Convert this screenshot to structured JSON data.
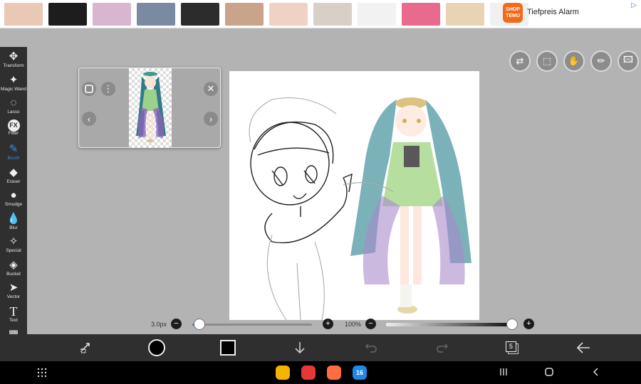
{
  "ad": {
    "brand_lines": [
      "SHOP",
      "TEMU"
    ],
    "title": "Tiefpreis Alarm",
    "choice_icon": "ad-choices-icon",
    "thumbs": [
      "#e9c9b5",
      "#1d1d1d",
      "#d9b6cf",
      "#7a8aa0",
      "#2c2c2c",
      "#c9a38a",
      "#f0d2c4",
      "#d8cfc6",
      "#f2f2f2",
      "#e86a8c",
      "#e8d3b5",
      "#f0f0f0"
    ]
  },
  "toolbar": {
    "tools": [
      {
        "label": "Transform",
        "icon": "move-arrows-icon",
        "glyph": "✥"
      },
      {
        "label": "Magic Wand",
        "icon": "magic-wand-icon",
        "glyph": "✦"
      },
      {
        "label": "Lasso",
        "icon": "lasso-icon",
        "glyph": "◌"
      },
      {
        "label": "Filter",
        "icon": "fx-icon",
        "glyph": "FX"
      },
      {
        "label": "Brush",
        "icon": "brush-icon",
        "glyph": "✎",
        "active": true
      },
      {
        "label": "Eraser",
        "icon": "eraser-icon",
        "glyph": "◆"
      },
      {
        "label": "Smudge",
        "icon": "smudge-icon",
        "glyph": "●"
      },
      {
        "label": "Blur",
        "icon": "blur-drop-icon",
        "glyph": "💧"
      },
      {
        "label": "Special",
        "icon": "special-brush-icon",
        "glyph": "✧"
      },
      {
        "label": "Bucket",
        "icon": "bucket-icon",
        "glyph": "◈"
      },
      {
        "label": "Vector",
        "icon": "vector-arrow-icon",
        "glyph": "➤"
      },
      {
        "label": "Text",
        "icon": "text-icon",
        "glyph": "T"
      },
      {
        "label": "Frame Divider",
        "icon": "frame-divider-icon",
        "glyph": "▦"
      },
      {
        "label": "",
        "icon": "eyedropper-icon",
        "glyph": "✒"
      }
    ]
  },
  "right_buttons": [
    {
      "name": "toggle-icon",
      "glyph": "⇄"
    },
    {
      "name": "selection-icon",
      "glyph": "⬚"
    },
    {
      "name": "hand-icon",
      "glyph": "✋"
    },
    {
      "name": "ruler-icon",
      "glyph": "✏"
    },
    {
      "name": "reference-image-icon",
      "glyph": "🖾"
    }
  ],
  "reference_window": {
    "frame_icon": "square-icon",
    "menu_icon": "more-vertical-icon",
    "close_icon": "close-icon",
    "prev_icon": "chevron-left-icon",
    "next_icon": "chevron-right-icon"
  },
  "brush_size": {
    "label": "3.0px",
    "fraction": 0.06
  },
  "opacity": {
    "label": "100%",
    "fraction": 1.0
  },
  "bottombar": {
    "icons": [
      "swap-brush-icon",
      "brush-color-icon",
      "layer-color-icon",
      "download-icon",
      "undo-icon",
      "redo-icon",
      "layers-icon",
      "back-arrow-icon"
    ],
    "layers_count": "5"
  },
  "navbar": {
    "apps": [
      {
        "name": "files-app-icon",
        "color": "#f4b400"
      },
      {
        "name": "flipboard-app-icon",
        "color": "#e53935"
      },
      {
        "name": "contacts-app-icon",
        "color": "#ff6e40"
      },
      {
        "name": "calendar-app-icon",
        "color": "#1e88e5",
        "text": "16"
      }
    ],
    "apps_grid_icon": "apps-grid-icon",
    "recents_icon": "recents-icon",
    "home_icon": "home-icon",
    "back_icon": "nav-back-icon"
  }
}
